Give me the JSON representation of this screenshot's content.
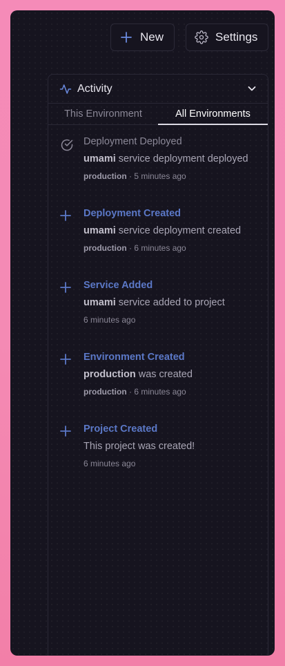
{
  "toolbar": {
    "new_label": "New",
    "settings_label": "Settings"
  },
  "activity": {
    "title": "Activity",
    "tabs": [
      "This Environment",
      "All Environments"
    ],
    "active_tab": "All Environments",
    "items": [
      {
        "icon": "check-circle-icon",
        "title": "Deployment Deployed",
        "subject": "umami",
        "text": " service deployment deployed",
        "env": "production",
        "sep": " · ",
        "time": "5 minutes ago"
      },
      {
        "icon": "plus-icon",
        "title": "Deployment Created",
        "subject": "umami",
        "text": " service deployment created",
        "env": "production",
        "sep": " · ",
        "time": "6 minutes ago"
      },
      {
        "icon": "plus-icon",
        "title": "Service Added",
        "subject": "umami",
        "text": " service added to project",
        "env": "",
        "sep": "",
        "time": "6 minutes ago"
      },
      {
        "icon": "plus-icon",
        "title": "Environment Created",
        "subject": "production",
        "text": " was created",
        "env": "production",
        "sep": " · ",
        "time": "6 minutes ago"
      },
      {
        "icon": "plus-icon",
        "title": "Project Created",
        "subject": "",
        "text": "This project was created!",
        "env": "",
        "sep": "",
        "time": "6 minutes ago"
      }
    ]
  },
  "colors": {
    "accent": "#5b78c7",
    "background": "#16141f",
    "page": "#f58bb8"
  }
}
